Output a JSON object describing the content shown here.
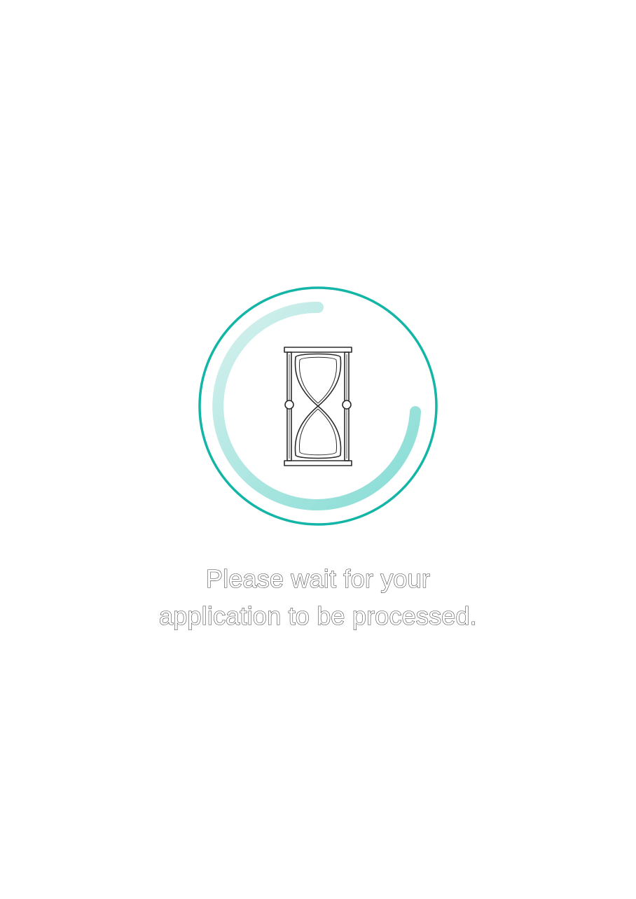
{
  "status": {
    "line1": "Please wait for your",
    "line2": "application to be processed."
  },
  "loader": {
    "icon": "hourglass-icon",
    "progress_arc": "spinner",
    "colors": {
      "ring": "#13b5a6",
      "arc_start": "#d7f1ee",
      "arc_end": "#84dcd4",
      "icon_stroke": "#2b2b2b"
    }
  }
}
